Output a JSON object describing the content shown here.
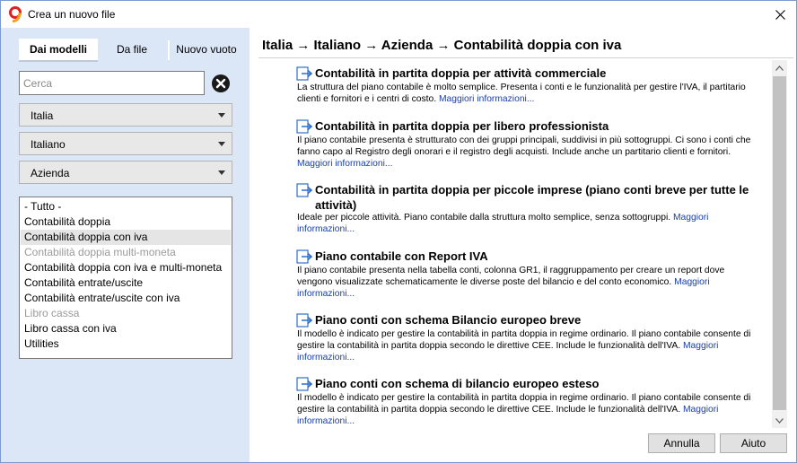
{
  "window": {
    "title": "Crea un nuovo file"
  },
  "tabs": [
    {
      "label": "Dai modelli",
      "active": true
    },
    {
      "label": "Da file",
      "active": false
    },
    {
      "label": "Nuovo vuoto",
      "active": false
    }
  ],
  "search": {
    "placeholder": "Cerca"
  },
  "filters": {
    "country": "Italia",
    "language": "Italiano",
    "type": "Azienda"
  },
  "categories": [
    {
      "label": "- Tutto -",
      "state": "normal"
    },
    {
      "label": "Contabilità doppia",
      "state": "normal"
    },
    {
      "label": "Contabilità doppia con iva",
      "state": "selected"
    },
    {
      "label": "Contabilità doppia multi-moneta",
      "state": "disabled"
    },
    {
      "label": "Contabilità doppia con iva e multi-moneta",
      "state": "normal"
    },
    {
      "label": "Contabilità entrate/uscite",
      "state": "normal"
    },
    {
      "label": "Contabilità entrate/uscite con iva",
      "state": "normal"
    },
    {
      "label": "Libro cassa",
      "state": "disabled"
    },
    {
      "label": "Libro cassa con iva",
      "state": "normal"
    },
    {
      "label": "Utilities",
      "state": "normal"
    }
  ],
  "breadcrumb": "Italia → Italiano → Azienda → Contabilità doppia con iva",
  "more_info_label": "Maggiori informazioni...",
  "templates": [
    {
      "title": "Contabilità in partita doppia per attività commerciale",
      "description": "La struttura del piano contabile è molto semplice. Presenta i conti e le funzionalità per gestire l'IVA, il partitario clienti e fornitori e i centri di costo."
    },
    {
      "title": "Contabilità in partita doppia per libero professionista",
      "description": "Il piano contabile presenta è strutturato con dei gruppi principali, suddivisi in più sottogruppi. Ci sono i conti che fanno capo al Registro degli onorari e il registro degli acquisti. Include anche un partitario clienti e fornitori."
    },
    {
      "title": "Contabilità in partita doppia per piccole imprese (piano conti breve per tutte le attività)",
      "description": "Ideale per piccole attività. Piano contabile dalla struttura molto semplice, senza sottogruppi."
    },
    {
      "title": "Piano contabile con Report IVA",
      "description": "Il piano contabile presenta nella tabella conti, colonna GR1, il raggruppamento per creare un report dove vengono visualizzate schematicamente le diverse poste del bilancio e del conto economico."
    },
    {
      "title": "Piano conti con schema Bilancio europeo breve",
      "description": "Il modello è indicato per gestire la contabilità in partita doppia in regime ordinario. Il piano contabile consente di gestire la contabilità in partita doppia secondo le direttive CEE. Include le funzionalità dell'IVA."
    },
    {
      "title": "Piano conti con schema di bilancio europeo esteso",
      "description": "Il modello è indicato per gestire la contabilità in partita doppia in regime ordinario. Il piano contabile consente di gestire la contabilità in partita doppia secondo le direttive CEE. Include le funzionalità dell'IVA."
    }
  ],
  "buttons": {
    "cancel": "Annulla",
    "help": "Aiuto"
  },
  "colors": {
    "left_panel_bg": "#dbe6f7",
    "link": "#1a3ea8",
    "icon_blue": "#2f6fc8",
    "app_icon_red": "#e02020",
    "app_icon_orange": "#f0a020"
  }
}
